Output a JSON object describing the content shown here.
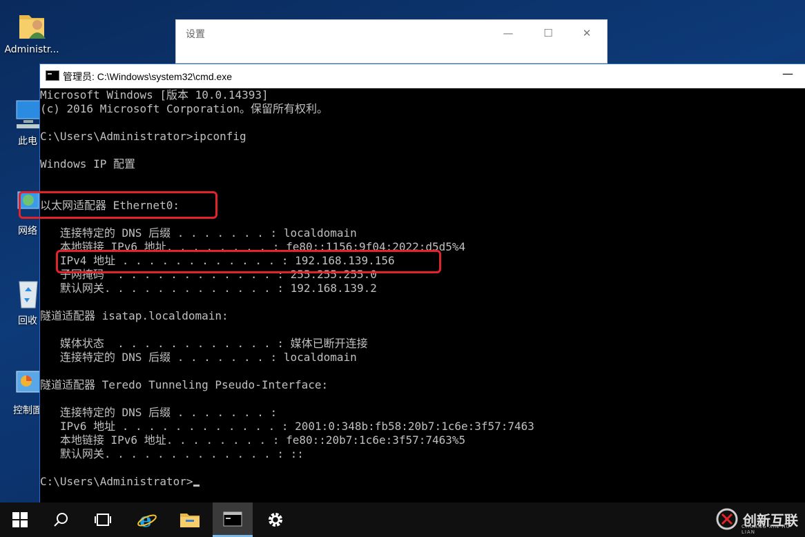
{
  "desktop": {
    "icons": [
      {
        "label": "Administr..."
      },
      {
        "label": "此电"
      },
      {
        "label": "网络"
      },
      {
        "label": "回收"
      },
      {
        "label": "控制面"
      }
    ]
  },
  "settings_window": {
    "title": "设置",
    "minimize": "—",
    "maximize": "☐",
    "close": "✕"
  },
  "cmd_window": {
    "title": "管理员: C:\\Windows\\system32\\cmd.exe",
    "minimize": "—",
    "lines": [
      "Microsoft Windows [版本 10.0.14393]",
      "(c) 2016 Microsoft Corporation。保留所有权利。",
      "",
      "C:\\Users\\Administrator>ipconfig",
      "",
      "Windows IP 配置",
      "",
      "",
      "以太网适配器 Ethernet0:",
      "",
      "   连接特定的 DNS 后缀 . . . . . . . : localdomain",
      "   本地链接 IPv6 地址. . . . . . . . : fe80::1156:9f04:2022:d5d5%4",
      "   IPv4 地址 . . . . . . . . . . . . : 192.168.139.156",
      "   子网掩码  . . . . . . . . . . . . : 255.255.255.0",
      "   默认网关. . . . . . . . . . . . . : 192.168.139.2",
      "",
      "隧道适配器 isatap.localdomain:",
      "",
      "   媒体状态  . . . . . . . . . . . . : 媒体已断开连接",
      "   连接特定的 DNS 后缀 . . . . . . . : localdomain",
      "",
      "隧道适配器 Teredo Tunneling Pseudo-Interface:",
      "",
      "   连接特定的 DNS 后缀 . . . . . . . :",
      "   IPv6 地址 . . . . . . . . . . . . : 2001:0:348b:fb58:20b7:1c6e:3f57:7463",
      "   本地链接 IPv6 地址. . . . . . . . : fe80::20b7:1c6e:3f57:7463%5",
      "   默认网关. . . . . . . . . . . . . : ::",
      "",
      "C:\\Users\\Administrator>"
    ]
  },
  "taskbar": {
    "watermark": "创新互联",
    "watermark_sub": "CHUANG XIN HU LIAN"
  },
  "colors": {
    "highlight_box": "#e0242a",
    "console_text": "#c0c0c0"
  }
}
